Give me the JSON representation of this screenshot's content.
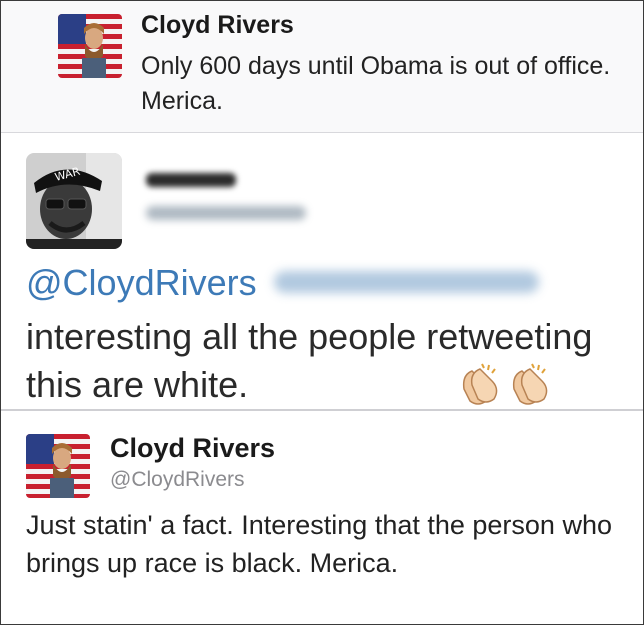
{
  "tweet1": {
    "name": "Cloyd Rivers",
    "text": "Only 600 days until Obama is out of office. Merica."
  },
  "tweet2": {
    "reply_to": "@CloydRivers",
    "text": "interesting all the people retweeting this are white.",
    "emoji": [
      "clapping-hands-emoji",
      "clapping-hands-emoji"
    ]
  },
  "tweet3": {
    "name": "Cloyd Rivers",
    "handle": "@CloydRivers",
    "text": "Just statin' a fact. Interesting that the person who brings up race is black. Merica."
  },
  "colors": {
    "mention_blue": "#3d7ab7",
    "handle_gray": "#8b8b8f",
    "card1_bg": "#f9f9fa"
  }
}
